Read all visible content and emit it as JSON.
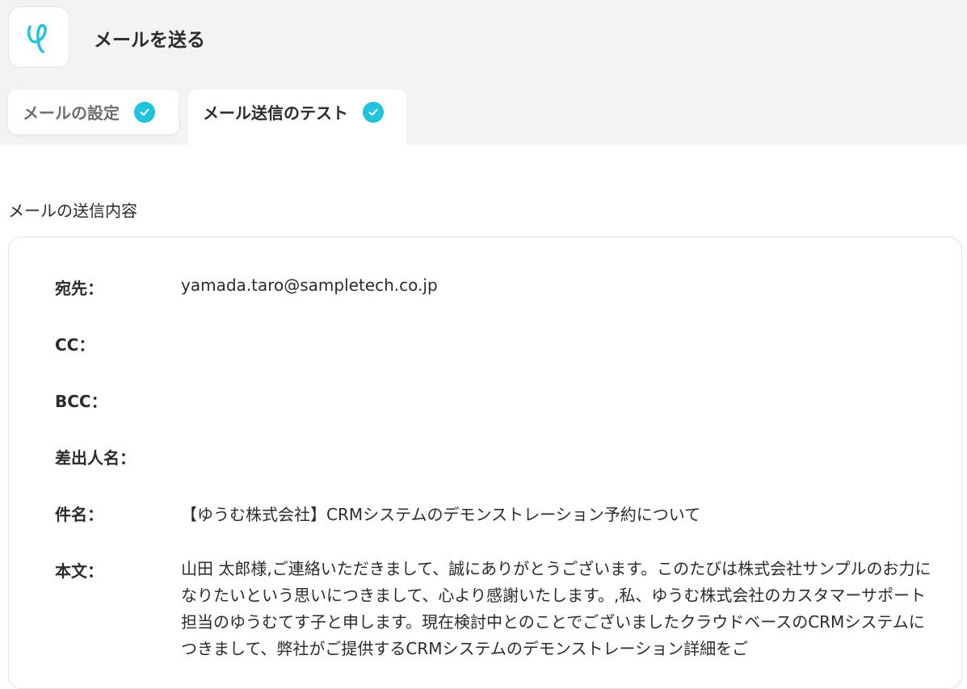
{
  "header": {
    "title": "メールを送る",
    "logo_icon": "yoom-logo-icon",
    "accent_color": "#21c3dc",
    "background_color": "#f3f3f3"
  },
  "tabs": [
    {
      "label": "メールの設定",
      "status_icon": "check-circle-icon",
      "active": false
    },
    {
      "label": "メール送信のテスト",
      "status_icon": "check-circle-icon",
      "active": true
    }
  ],
  "section": {
    "title": "メールの送信内容"
  },
  "mail": {
    "to_label": "宛先：",
    "to_value": "yamada.taro@sampletech.co.jp",
    "cc_label": "CC：",
    "cc_value": "",
    "bcc_label": "BCC：",
    "bcc_value": "",
    "sender_label": "差出人名：",
    "sender_value": "",
    "subject_label": "件名：",
    "subject_value": "【ゆうむ株式会社】CRMシステムのデモンストレーション予約について",
    "body_label": "本文：",
    "body_value": "山田 太郎様,ご連絡いただきまして、誠にありがとうございます。このたびは株式会社サンプルのお力になりたいという思いにつきまして、心より感謝いたします。,私、ゆうむ株式会社のカスタマーサポート担当のゆうむてす子と申します。現在検討中とのことでございましたクラウドベースのCRMシステムにつきまして、弊社がご提供するCRMシステムのデモンストレーション詳細をご"
  }
}
